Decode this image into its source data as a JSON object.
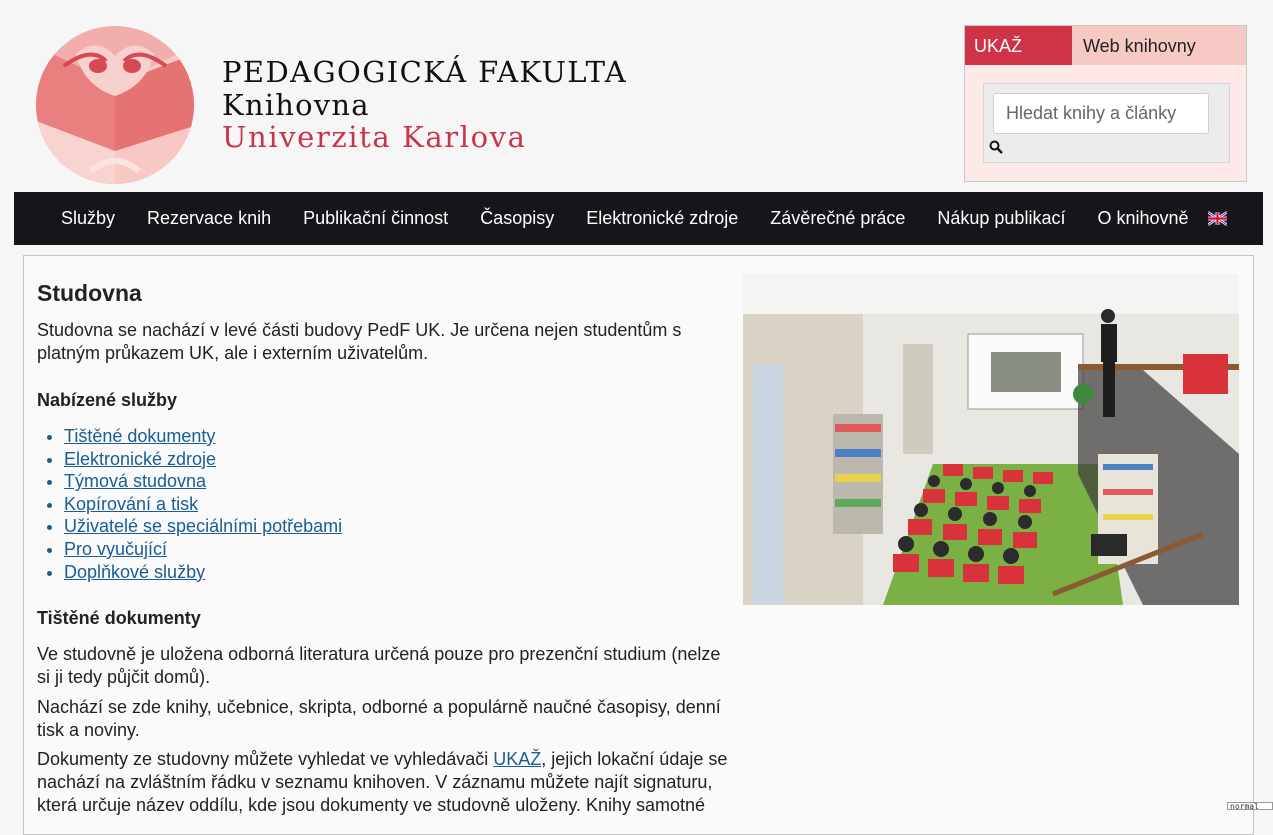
{
  "header": {
    "line1": "PEDAGOGICKÁ FAKULTA",
    "line2": "Knihovna",
    "line3": "Univerzita Karlova",
    "brand_color": "#c8354a"
  },
  "search": {
    "tab_active": "UKAŽ",
    "tab_inactive": "Web knihovny",
    "placeholder": "Hledat knihy a články",
    "icon": "search-icon",
    "accent": "#cf3347"
  },
  "nav": {
    "items": [
      "Služby",
      "Rezervace knih",
      "Publikační činnost",
      "Časopisy",
      "Elektronické zdroje",
      "Závěrečné práce",
      "Nákup publikací",
      "O knihovně"
    ],
    "lang_icon": "uk-flag-icon"
  },
  "main": {
    "title": "Studovna",
    "intro": "Studovna se nachází v levé části budovy PedF UK. Je určena nejen studentům s platným průkazem UK, ale i externím uživatelům.",
    "services_heading": "Nabízené služby",
    "services": [
      "Tištěné dokumenty",
      "Elektronické zdroje",
      "Týmová studovna",
      "Kopírování a tisk",
      "Uživatelé se speciálními potřebami",
      "Pro vyučující",
      "Doplňkové služby"
    ],
    "printed_heading": "Tištěné dokumenty",
    "para1": "Ve studovně je uložena odborná literatura určená pouze pro prezenční studium (nelze si ji tedy půjčit domů).",
    "para2": "Nachází se zde knihy, učebnice, skripta, odborné a populárně naučné časopisy, denní tisk a noviny.",
    "para3_before": "Dokumenty ze studovny můžete vyhledat ve vyhledávači ",
    "para3_link": "UKAŽ",
    "para3_after": ", jejich lokační údaje se nachází na zvláštním řádku v seznamu knihoven. V záznamu můžete najít signaturu, která určuje název oddílu, kde jsou dokumenty ve studovně uloženy. Knihy samotné"
  },
  "corner_tag": "normal"
}
